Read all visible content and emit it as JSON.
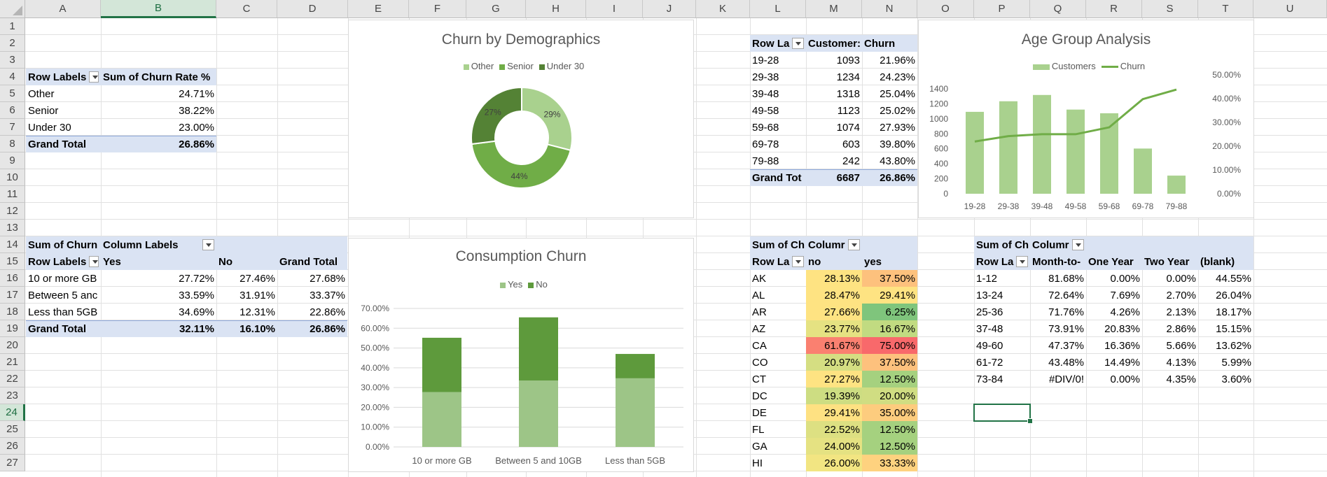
{
  "columns": [
    "A",
    "B",
    "C",
    "D",
    "E",
    "F",
    "G",
    "H",
    "I",
    "J",
    "K",
    "L",
    "M",
    "N",
    "O",
    "P",
    "Q",
    "R",
    "S",
    "T",
    "U"
  ],
  "rows": [
    "1",
    "2",
    "3",
    "4",
    "5",
    "6",
    "7",
    "8",
    "9",
    "10",
    "11",
    "12",
    "13",
    "14",
    "15",
    "16",
    "17",
    "18",
    "19",
    "20",
    "21",
    "22",
    "23",
    "24",
    "25",
    "26",
    "27"
  ],
  "colors": {
    "light_green": "#a9d18e",
    "mid_green": "#70ad47",
    "dark_green": "#548235",
    "header_blue": "#dae3f3"
  },
  "pivot_demo": {
    "hdr_label": "Row Labels",
    "hdr_value": "Sum of Churn Rate %",
    "rows": [
      {
        "label": "Other",
        "value": "24.71%"
      },
      {
        "label": "Senior",
        "value": "38.22%"
      },
      {
        "label": "Under 30",
        "value": "23.00%"
      }
    ],
    "total_label": "Grand Total",
    "total_value": "26.86%"
  },
  "pivot_consumption": {
    "title_a": "Sum of Churn",
    "title_b": "Column Labels",
    "hdr_row": "Row Labels",
    "hdr_yes": "Yes",
    "hdr_no": "No",
    "hdr_total": "Grand Total",
    "rows": [
      {
        "label": "10 or more GB",
        "yes": "27.72%",
        "no": "27.46%",
        "total": "27.68%"
      },
      {
        "label": "Between 5 anc",
        "yes": "33.59%",
        "no": "31.91%",
        "total": "33.37%"
      },
      {
        "label": "Less than 5GB",
        "yes": "34.69%",
        "no": "12.31%",
        "total": "22.86%"
      }
    ],
    "total_label": "Grand Total",
    "total_yes": "32.11%",
    "total_no": "16.10%",
    "total_total": "26.86%"
  },
  "pivot_age": {
    "hdr_row": "Row La",
    "hdr_customers": "Customer:",
    "hdr_churn": "Churn",
    "rows": [
      {
        "label": "19-28",
        "customers": "1093",
        "churn": "21.96%"
      },
      {
        "label": "29-38",
        "customers": "1234",
        "churn": "24.23%"
      },
      {
        "label": "39-48",
        "customers": "1318",
        "churn": "25.04%"
      },
      {
        "label": "49-58",
        "customers": "1123",
        "churn": "25.02%"
      },
      {
        "label": "59-68",
        "customers": "1074",
        "churn": "27.93%"
      },
      {
        "label": "69-78",
        "customers": "603",
        "churn": "39.80%"
      },
      {
        "label": "79-88",
        "customers": "242",
        "churn": "43.80%"
      }
    ],
    "total_label": "Grand Tot",
    "total_customers": "6687",
    "total_churn": "26.86%"
  },
  "pivot_state": {
    "title_a": "Sum of Ch",
    "title_b": "Columr",
    "hdr_row": "Row La",
    "hdr_no": "no",
    "hdr_yes": "yes",
    "rows": [
      {
        "label": "AK",
        "no": "28.13%",
        "yes": "37.50%",
        "no_color": "#fee382",
        "yes_color": "#fdc17d"
      },
      {
        "label": "AL",
        "no": "28.47%",
        "yes": "29.41%",
        "no_color": "#fee382",
        "yes_color": "#fee382"
      },
      {
        "label": "AR",
        "no": "27.66%",
        "yes": "6.25%",
        "no_color": "#fee382",
        "yes_color": "#7fc57c"
      },
      {
        "label": "AZ",
        "no": "23.77%",
        "yes": "16.67%",
        "no_color": "#e5e282",
        "yes_color": "#c1db81"
      },
      {
        "label": "CA",
        "no": "61.67%",
        "yes": "75.00%",
        "no_color": "#fa8070",
        "yes_color": "#f8696b"
      },
      {
        "label": "CO",
        "no": "20.97%",
        "yes": "37.50%",
        "no_color": "#d5de82",
        "yes_color": "#fdc17d"
      },
      {
        "label": "CT",
        "no": "27.27%",
        "yes": "12.50%",
        "no_color": "#fee382",
        "yes_color": "#a5d17f"
      },
      {
        "label": "DC",
        "no": "19.39%",
        "yes": "20.00%",
        "no_color": "#cddd82",
        "yes_color": "#d0dd82"
      },
      {
        "label": "DE",
        "no": "29.41%",
        "yes": "35.00%",
        "no_color": "#fee182",
        "yes_color": "#fdcc7e"
      },
      {
        "label": "FL",
        "no": "22.52%",
        "yes": "12.50%",
        "no_color": "#dde082",
        "yes_color": "#a5d17f"
      },
      {
        "label": "GA",
        "no": "24.00%",
        "yes": "12.50%",
        "no_color": "#e5e282",
        "yes_color": "#a5d17f"
      },
      {
        "label": "HI",
        "no": "26.00%",
        "yes": "33.33%",
        "no_color": "#f2e582",
        "yes_color": "#fed27f"
      }
    ]
  },
  "pivot_contract": {
    "title_a": "Sum of Ch",
    "title_b": "Columr",
    "hdr_row": "Row La",
    "hdr_month": "Month-to-",
    "hdr_one": "One Year",
    "hdr_two": "Two Year",
    "hdr_blank": "(blank)",
    "rows": [
      {
        "label": "1-12",
        "month": "81.68%",
        "one": "0.00%",
        "two": "0.00%",
        "blank": "44.55%"
      },
      {
        "label": "13-24",
        "month": "72.64%",
        "one": "7.69%",
        "two": "2.70%",
        "blank": "26.04%"
      },
      {
        "label": "25-36",
        "month": "71.76%",
        "one": "4.26%",
        "two": "2.13%",
        "blank": "18.17%"
      },
      {
        "label": "37-48",
        "month": "73.91%",
        "one": "20.83%",
        "two": "2.86%",
        "blank": "15.15%"
      },
      {
        "label": "49-60",
        "month": "47.37%",
        "one": "16.36%",
        "two": "5.66%",
        "blank": "13.62%"
      },
      {
        "label": "61-72",
        "month": "43.48%",
        "one": "14.49%",
        "two": "4.13%",
        "blank": "5.99%"
      },
      {
        "label": "73-84",
        "month": "#DIV/0!",
        "one": "0.00%",
        "two": "4.35%",
        "blank": "3.60%"
      }
    ]
  },
  "chart_data": [
    {
      "type": "pie",
      "title": "Churn by Demographics",
      "categories": [
        "Other",
        "Senior",
        "Under 30"
      ],
      "values": [
        29,
        44,
        27
      ],
      "labels": [
        "29%",
        "44%",
        "27%"
      ],
      "colors": [
        "#a9d18e",
        "#70ad47",
        "#548235"
      ],
      "legend": "top"
    },
    {
      "type": "bar",
      "title": "Consumption Churn",
      "categories": [
        "10 or more GB",
        "Between 5 and 10GB",
        "Less than 5GB"
      ],
      "series": [
        {
          "name": "Yes",
          "values": [
            27.72,
            33.59,
            34.69
          ],
          "color": "#9dc587"
        },
        {
          "name": "No",
          "values": [
            27.46,
            31.91,
            12.31
          ],
          "color": "#5e9a3c"
        }
      ],
      "stacked": true,
      "ylim": [
        0,
        70
      ],
      "yticks": [
        "0.00%",
        "10.00%",
        "20.00%",
        "30.00%",
        "40.00%",
        "50.00%",
        "60.00%",
        "70.00%"
      ],
      "legend": "top",
      "grid": true
    },
    {
      "type": "bar",
      "title": "Age Group Analysis",
      "categories": [
        "19-28",
        "29-38",
        "39-48",
        "49-58",
        "59-68",
        "69-78",
        "79-88"
      ],
      "series": [
        {
          "name": "Customers",
          "values": [
            1093,
            1234,
            1318,
            1123,
            1074,
            603,
            242
          ],
          "color": "#a9d18e",
          "axis": "left"
        },
        {
          "name": "Churn",
          "type": "line",
          "values": [
            21.96,
            24.23,
            25.04,
            25.02,
            27.93,
            39.8,
            43.8
          ],
          "color": "#70ad47",
          "axis": "right"
        }
      ],
      "ylim": [
        0,
        1400
      ],
      "yticks": [
        "0",
        "200",
        "400",
        "600",
        "800",
        "1000",
        "1200",
        "1400"
      ],
      "y2lim": [
        0,
        50
      ],
      "y2ticks": [
        "0.00%",
        "10.00%",
        "20.00%",
        "30.00%",
        "40.00%",
        "50.00%"
      ],
      "legend": "top"
    }
  ]
}
